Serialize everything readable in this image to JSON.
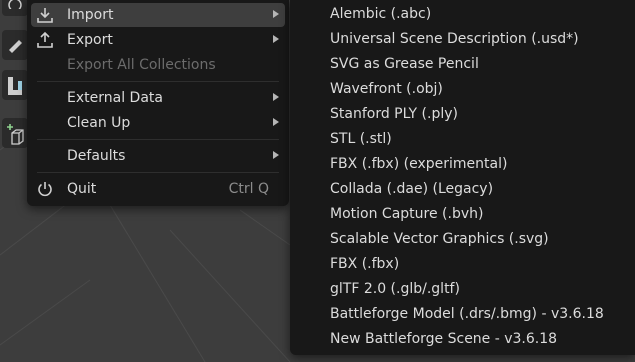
{
  "file_menu": {
    "items": [
      {
        "label": "Import",
        "icon": "import-icon",
        "has_submenu": true,
        "highlighted": true
      },
      {
        "label": "Export",
        "icon": "export-icon",
        "has_submenu": true
      },
      {
        "label": "Export All Collections",
        "disabled": true
      },
      {
        "label": "External Data",
        "has_submenu": true
      },
      {
        "label": "Clean Up",
        "has_submenu": true
      },
      {
        "label": "Defaults",
        "has_submenu": true
      },
      {
        "label": "Quit",
        "icon": "power-icon",
        "shortcut": "Ctrl Q"
      }
    ]
  },
  "import_submenu": {
    "items": [
      {
        "label": "Alembic (.abc)"
      },
      {
        "label": "Universal Scene Description (.usd*)"
      },
      {
        "label": "SVG as Grease Pencil"
      },
      {
        "label": "Wavefront (.obj)"
      },
      {
        "label": "Stanford PLY (.ply)"
      },
      {
        "label": "STL (.stl)"
      },
      {
        "label": "FBX (.fbx) (experimental)"
      },
      {
        "label": "Collada (.dae) (Legacy)"
      },
      {
        "label": "Motion Capture (.bvh)"
      },
      {
        "label": "Scalable Vector Graphics (.svg)"
      },
      {
        "label": "FBX (.fbx)"
      },
      {
        "label": "glTF 2.0 (.glb/.gltf)"
      },
      {
        "label": "Battleforge Model (.drs/.bmg) -  v3.6.18"
      },
      {
        "label": "New Battleforge Scene -  v3.6.18"
      }
    ]
  },
  "colors": {
    "menu_background": "#181818",
    "highlight": "#3e3e3e",
    "viewport": "#3d3d3d",
    "text": "#dcdcdc",
    "disabled_text": "#6c6c6c",
    "shortcut_text": "#8c8c8c"
  }
}
